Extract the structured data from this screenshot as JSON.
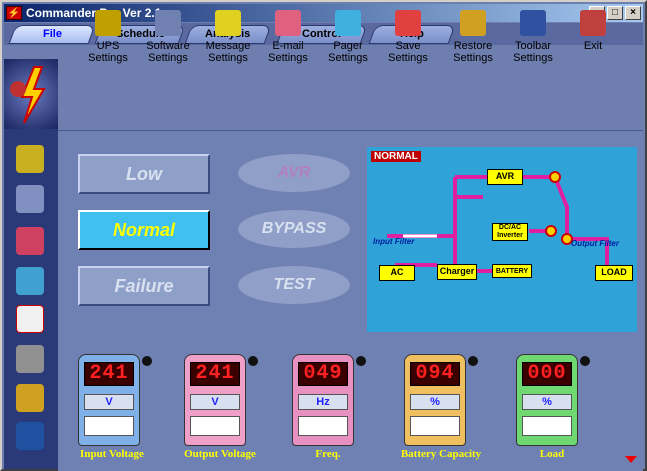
{
  "window": {
    "title": "Commander Pro Ver 2.1",
    "min_label": "_",
    "max_label": "□",
    "close_label": "×"
  },
  "menu": [
    "File",
    "Schedule",
    "Analysis",
    "Control",
    "Help"
  ],
  "toolbar": [
    {
      "label": "UPS Settings",
      "icon": "ups-settings-icon"
    },
    {
      "label": "Software Settings",
      "icon": "software-settings-icon"
    },
    {
      "label": "Message Settings",
      "icon": "message-settings-icon"
    },
    {
      "label": "E-mail Settings",
      "icon": "email-settings-icon"
    },
    {
      "label": "Pager Settings",
      "icon": "pager-settings-icon"
    },
    {
      "label": "Save Settings",
      "icon": "save-settings-icon"
    },
    {
      "label": "Restore Settings",
      "icon": "restore-settings-icon"
    },
    {
      "label": "Toolbar Settings",
      "icon": "toolbar-settings-icon"
    },
    {
      "label": "Exit",
      "icon": "exit-icon"
    }
  ],
  "status_buttons": {
    "low": "Low",
    "normal": "Normal",
    "failure": "Failure",
    "avr": "AVR",
    "bypass": "BYPASS",
    "test": "TEST"
  },
  "diagram": {
    "mode": "NORMAL",
    "avr": "AVR",
    "dcac": "DC/AC Inverter",
    "input_filter": "Input Filter",
    "output_filter": "Output Filter",
    "ac": "AC",
    "charger": "Charger",
    "battery": "BATTERY",
    "load": "LOAD"
  },
  "meters": [
    {
      "value": "241",
      "unit": "V",
      "label": "Input Voltage",
      "color": "#7fb0e8"
    },
    {
      "value": "241",
      "unit": "V",
      "label": "Output Voltage",
      "color": "#f0a0c8"
    },
    {
      "value": "049",
      "unit": "Hz",
      "label": "Freq.",
      "color": "#e890c0"
    },
    {
      "value": "094",
      "unit": "%",
      "label": "Battery Capacity",
      "color": "#f0c060"
    },
    {
      "value": "000",
      "unit": "%",
      "label": "Load",
      "color": "#70d870"
    }
  ]
}
